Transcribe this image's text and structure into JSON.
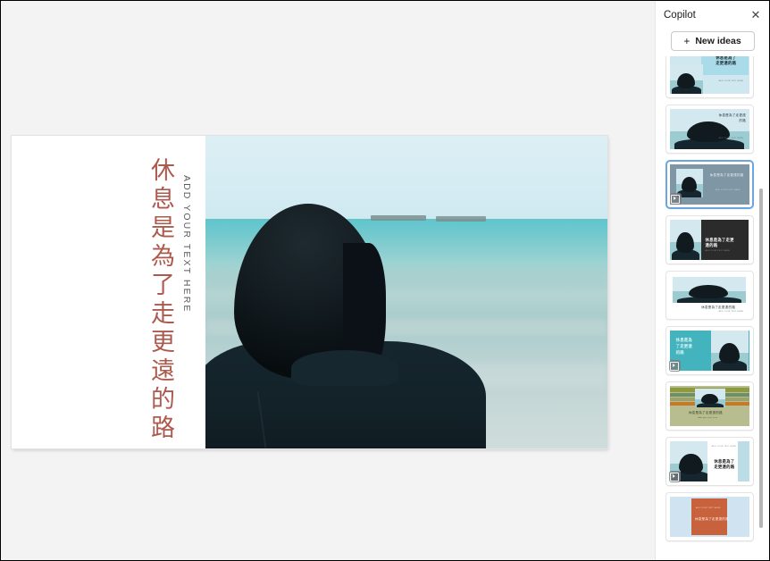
{
  "canvas": {
    "background_color": "#f3f3f3",
    "slide": {
      "headline_vertical": "休息是為了走更遠的路",
      "subtitle_vertical": "ADD YOUR TEXT HERE",
      "headline_color": "#ad5a4e",
      "subtitle_color": "#5d5d5d",
      "background_color": "#ffffff",
      "photo_alt": "person with black bob haircut facing turquoise sea"
    }
  },
  "copilot": {
    "title": "Copilot",
    "close_label": "✕",
    "new_ideas": {
      "label": "New ideas",
      "icon": "plus-icon"
    },
    "selected_index": 2,
    "accent_color": "#6aa6dd",
    "designs": [
      {
        "name": "design-light-blue-top-text",
        "layout": "photo-left-text-right-band",
        "bg": "#cfe7ef",
        "title": "休息是為了\n走更遠的路",
        "caption": "ADD YOUR TEXT HERE",
        "has_video_badge": false,
        "clipped": true
      },
      {
        "name": "design-light-blue-right-text",
        "layout": "full-photo-right-text",
        "bg": "#bcdce6",
        "title": "休息是為了走更遠\n的路",
        "caption": "ADD YOUR TEXT HERE",
        "has_video_badge": false,
        "clipped": false
      },
      {
        "name": "design-slate-framed-photo",
        "layout": "slate-panel-framed-photo",
        "bg": "#7f96a5",
        "title": "休息是為了走更遠的路",
        "caption": "ADD YOUR TEXT HERE",
        "has_video_badge": true,
        "clipped": false
      },
      {
        "name": "design-dark-panel-right",
        "layout": "photo-left-dark-panel-right",
        "bg": "#2b2b2b",
        "title": "休息是為了走更\n遠的路",
        "caption": "ADD YOUR TEXT HERE",
        "has_video_badge": false,
        "clipped": false
      },
      {
        "name": "design-white-photo-top",
        "layout": "photo-top-white-caption-bottom",
        "bg": "#ffffff",
        "title": "休息是為了走更遠的路",
        "caption": "ADD YOUR TEXT HERE",
        "has_video_badge": false,
        "clipped": false
      },
      {
        "name": "design-teal-panel-left",
        "layout": "teal-panel-left-photo-right",
        "bg": "#43b3be",
        "title": "休息是為\n了走更遠\n的路",
        "caption": "",
        "has_video_badge": true,
        "clipped": false
      },
      {
        "name": "design-olive-stripes",
        "layout": "olive-stripe-bands-center-photo",
        "bg": "#9aa469",
        "title": "休息是為了走更遠的路",
        "caption": "Add your text here",
        "has_video_badge": false,
        "clipped": false
      },
      {
        "name": "design-white-card-center",
        "layout": "photo-left-white-card-center",
        "bg": "#ffffff",
        "title": "休息是為了\n走更遠的路",
        "caption": "ADD YOUR TEXT HERE",
        "has_video_badge": true,
        "clipped": false
      },
      {
        "name": "design-orange-center-box",
        "layout": "light-blue-bg-orange-center-box",
        "bg": "#c8623c",
        "title": "休息是為了走更遠的路",
        "caption": "ADD YOUR TEXT HERE",
        "has_video_badge": false,
        "clipped": true
      }
    ]
  },
  "scrollbar": {
    "name": "designs-scrollbar",
    "orientation": "vertical"
  }
}
